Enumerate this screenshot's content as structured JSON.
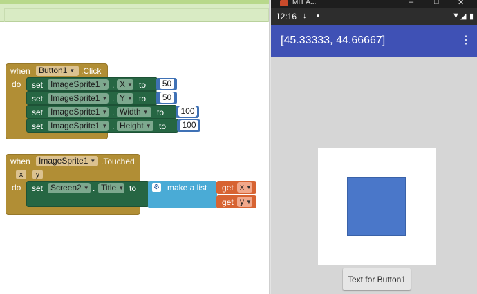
{
  "workspace": {
    "block1": {
      "when": "when",
      "event_component": "Button1",
      "event_name": ".Click",
      "do": "do",
      "rows": [
        {
          "set": "set",
          "component": "ImageSprite1",
          "dot": ".",
          "property": "X",
          "to": "to",
          "value": "50"
        },
        {
          "set": "set",
          "component": "ImageSprite1",
          "dot": ".",
          "property": "Y",
          "to": "to",
          "value": "50"
        },
        {
          "set": "set",
          "component": "ImageSprite1",
          "dot": ".",
          "property": "Width",
          "to": "to",
          "value": "100"
        },
        {
          "set": "set",
          "component": "ImageSprite1",
          "dot": ".",
          "property": "Height",
          "to": "to",
          "value": "100"
        }
      ]
    },
    "block2": {
      "when": "when",
      "event_component": "ImageSprite1",
      "event_name": ".Touched",
      "params": [
        "x",
        "y"
      ],
      "do": "do",
      "set": "set",
      "component": "Screen2",
      "dot": ".",
      "property": "Title",
      "to": "to",
      "make_list": "make a list",
      "gets": [
        {
          "label": "get",
          "var": "x"
        },
        {
          "label": "get",
          "var": "y"
        }
      ]
    }
  },
  "phone": {
    "window_title": "MIT A...",
    "window_buttons": [
      "–",
      "□",
      "✕"
    ],
    "status_time": "12:16",
    "status_icons": [
      "↓",
      "▪"
    ],
    "status_right_icons": [
      "▼",
      "◢",
      "▮"
    ],
    "screen_title": "[45.33333, 44.66667]",
    "menu_icon": "⋮",
    "button_text": "Text for Button1",
    "sprite_color": "#4a77c9",
    "appbar_color": "#3f51b5",
    "canvas_color": "#ffffff"
  }
}
